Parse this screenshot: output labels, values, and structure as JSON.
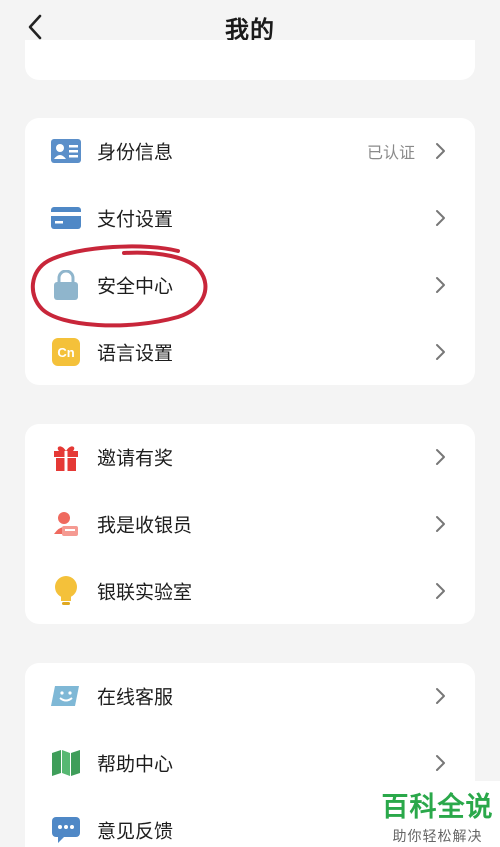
{
  "header": {
    "title": "我的"
  },
  "sections": [
    {
      "items": [
        {
          "label": "身份信息",
          "value": "已认证",
          "icon": "id-card-icon",
          "color": "#5b8fc9"
        },
        {
          "label": "支付设置",
          "icon": "bank-card-icon",
          "color": "#4f88c6"
        },
        {
          "label": "安全中心",
          "icon": "lock-icon",
          "color": "#8fb5cc"
        },
        {
          "label": "语言设置",
          "icon": "language-cn-icon",
          "color": "#f4c13a"
        }
      ]
    },
    {
      "items": [
        {
          "label": "邀请有奖",
          "icon": "gift-icon",
          "color": "#e53935"
        },
        {
          "label": "我是收银员",
          "icon": "cashier-icon",
          "color": "#ef6a5f"
        },
        {
          "label": "银联实验室",
          "icon": "lightbulb-icon",
          "color": "#f4c13a"
        }
      ]
    },
    {
      "items": [
        {
          "label": "在线客服",
          "icon": "customer-service-icon",
          "color": "#7fb8d6"
        },
        {
          "label": "帮助中心",
          "icon": "book-icon",
          "color": "#3f9e5a"
        },
        {
          "label": "意见反馈",
          "icon": "chat-bubble-icon",
          "color": "#4f88c6"
        }
      ]
    }
  ],
  "watermark": {
    "brand": "百科全说",
    "slogan": "助你轻松解决"
  }
}
